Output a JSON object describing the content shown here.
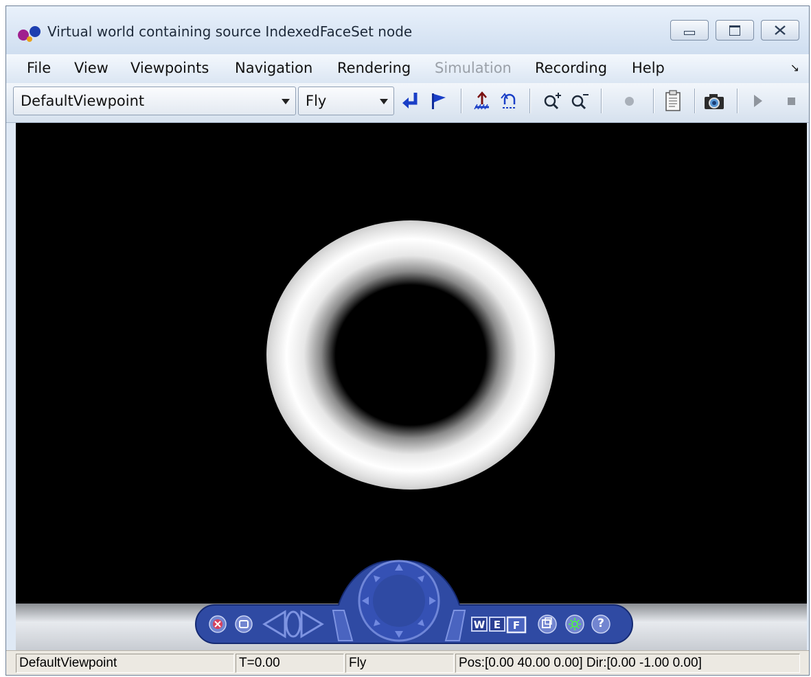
{
  "window": {
    "title": "Virtual world containing source IndexedFaceSet node",
    "controls": [
      "minimize",
      "maximize",
      "close"
    ]
  },
  "menu": {
    "items": [
      {
        "label": "File",
        "enabled": true
      },
      {
        "label": "View",
        "enabled": true
      },
      {
        "label": "Viewpoints",
        "enabled": true
      },
      {
        "label": "Navigation",
        "enabled": true
      },
      {
        "label": "Rendering",
        "enabled": true
      },
      {
        "label": "Simulation",
        "enabled": false
      },
      {
        "label": "Recording",
        "enabled": true
      },
      {
        "label": "Help",
        "enabled": true
      }
    ]
  },
  "toolbar": {
    "viewpoint_select": "DefaultViewpoint",
    "navigation_select": "Fly",
    "buttons": [
      "return-to-viewpoint",
      "create-viewpoint",
      "straighten-up",
      "undo-move",
      "zoom-in",
      "zoom-out",
      "record",
      "vrml-editor",
      "snapshot",
      "start-simulation",
      "stop-simulation"
    ]
  },
  "scene": {
    "background": "#000000",
    "object": "torus"
  },
  "navpanel": {
    "buttons": [
      "hide-panel",
      "panel-mode",
      "viewpoint-previous",
      "viewpoint-home",
      "viewpoint-next",
      "navigation-wheel",
      "walk",
      "examine",
      "fly",
      "headlight-toggle",
      "lighting",
      "help"
    ],
    "mode_labels": {
      "walk": "W",
      "examine": "E",
      "fly": "F"
    },
    "help_label": "?"
  },
  "status": {
    "viewpoint": "DefaultViewpoint",
    "time": "T=0.00",
    "mode": "Fly",
    "position": "Pos:[0.00 40.00 0.00] Dir:[0.00 -1.00 0.00]"
  },
  "colors": {
    "navpanel": "#2f4aa3",
    "title_accent": "#1d4fc4"
  }
}
